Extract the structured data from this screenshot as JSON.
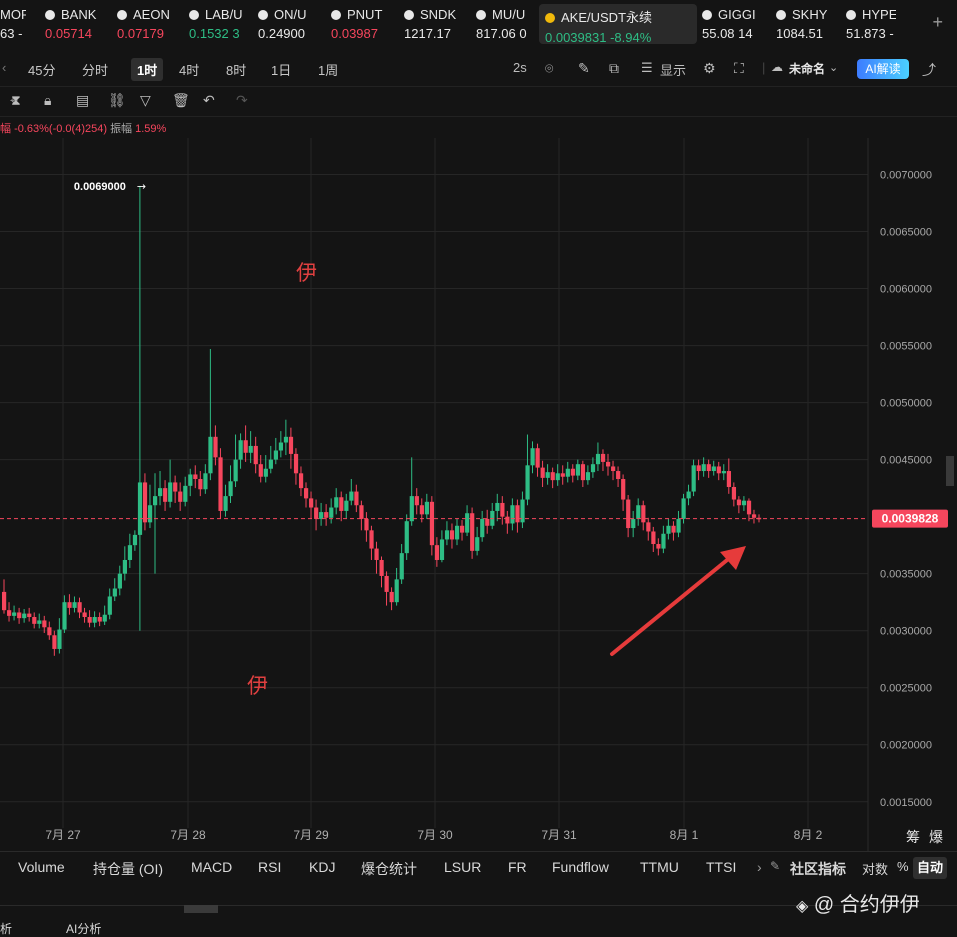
{
  "ticker": [
    {
      "symbol": "MORI",
      "price": "63 -",
      "color": "white"
    },
    {
      "symbol": "BANK",
      "price": "0.05714",
      "color": "red"
    },
    {
      "symbol": "AEON",
      "price": "0.07179",
      "color": "red"
    },
    {
      "symbol": "LAB/U",
      "price": "0.1532 3",
      "color": "green"
    },
    {
      "symbol": "ON/U",
      "price": "0.24900",
      "color": "white"
    },
    {
      "symbol": "PNUT",
      "price": "0.03987",
      "color": "red"
    },
    {
      "symbol": "SNDK",
      "price": "1217.17",
      "color": "white"
    },
    {
      "symbol": "MU/U",
      "price": "817.06 0",
      "color": "white"
    },
    {
      "symbol": "AKE/USDT永续",
      "price": "0.0039831 -8.94%",
      "color": "green",
      "active": true
    },
    {
      "symbol": "GIGGI",
      "price": "55.08 14",
      "color": "white"
    },
    {
      "symbol": "SKHY",
      "price": "1084.51",
      "color": "white"
    },
    {
      "symbol": "HYPE",
      "price": "51.873 -",
      "color": "white"
    }
  ],
  "add_label": "+",
  "timeframes": [
    "45分",
    "分时",
    "1时",
    "4时",
    "8时",
    "1日",
    "1周"
  ],
  "timeframe_selected": "1时",
  "toolbar": {
    "interval": "2s",
    "display": "显示",
    "layout_name": "未命名",
    "ai": "AI解读"
  },
  "info_line": {
    "prefix": "幅",
    "change": "-0.63%(-0.0(4)254)",
    "amp_label": "振幅",
    "amp_value": "1.59%"
  },
  "chart_data": {
    "type": "candlestick",
    "pair": "AKE/USDT永续",
    "y_ticks": [
      "0.0070000",
      "0.0065000",
      "0.0060000",
      "0.0055000",
      "0.0050000",
      "0.0045000",
      "0.0035000",
      "0.0030000",
      "0.0025000",
      "0.0020000",
      "0.0015000"
    ],
    "x_ticks": [
      "7月 27",
      "7月 28",
      "7月 29",
      "7月 30",
      "7月 31",
      "8月 1",
      "8月 2"
    ],
    "ylim": [
      0.00127,
      0.00732
    ],
    "current_price": "0.0039828",
    "current_value": 0.0039828,
    "high_label": "0.0069000",
    "high_value": 0.0069,
    "annotations": [
      "伊",
      "伊"
    ],
    "colors": {
      "up": "#2ebd85",
      "down": "#f6465d",
      "grid": "#262626"
    },
    "candles": [
      [
        0.00334,
        0.00318,
        0.00345,
        0.00315
      ],
      [
        0.00318,
        0.00313,
        0.00325,
        0.00308
      ],
      [
        0.00313,
        0.00316,
        0.00322,
        0.00309
      ],
      [
        0.00316,
        0.00311,
        0.0032,
        0.00306
      ],
      [
        0.00311,
        0.00315,
        0.00319,
        0.00307
      ],
      [
        0.00315,
        0.00312,
        0.0032,
        0.00308
      ],
      [
        0.00312,
        0.00306,
        0.00316,
        0.00302
      ],
      [
        0.00306,
        0.00309,
        0.00315,
        0.00302
      ],
      [
        0.00309,
        0.00303,
        0.00313,
        0.00298
      ],
      [
        0.00303,
        0.00296,
        0.00308,
        0.00292
      ],
      [
        0.00296,
        0.00284,
        0.003,
        0.00278
      ],
      [
        0.00284,
        0.00301,
        0.00311,
        0.0028
      ],
      [
        0.00301,
        0.00325,
        0.00331,
        0.00298
      ],
      [
        0.00325,
        0.0032,
        0.00332,
        0.00314
      ],
      [
        0.0032,
        0.00325,
        0.0033,
        0.00316
      ],
      [
        0.00325,
        0.00316,
        0.00329,
        0.00311
      ],
      [
        0.00316,
        0.00312,
        0.0032,
        0.00307
      ],
      [
        0.00312,
        0.00307,
        0.00318,
        0.00303
      ],
      [
        0.00307,
        0.00312,
        0.00317,
        0.00303
      ],
      [
        0.00312,
        0.00308,
        0.00316,
        0.00304
      ],
      [
        0.00308,
        0.00314,
        0.00322,
        0.00305
      ],
      [
        0.00314,
        0.0033,
        0.00337,
        0.0031
      ],
      [
        0.0033,
        0.00337,
        0.00346,
        0.00326
      ],
      [
        0.00337,
        0.0035,
        0.00357,
        0.00331
      ],
      [
        0.0035,
        0.00362,
        0.00374,
        0.00344
      ],
      [
        0.00362,
        0.00375,
        0.00385,
        0.00355
      ],
      [
        0.00375,
        0.00384,
        0.00388,
        0.0037
      ],
      [
        0.00384,
        0.0043,
        0.0069,
        0.003
      ],
      [
        0.0043,
        0.00395,
        0.00438,
        0.00388
      ],
      [
        0.00395,
        0.0041,
        0.00428,
        0.0039
      ],
      [
        0.0041,
        0.00418,
        0.00438,
        0.0035
      ],
      [
        0.00418,
        0.00425,
        0.0044,
        0.0041
      ],
      [
        0.00425,
        0.00413,
        0.00432,
        0.00405
      ],
      [
        0.00413,
        0.0043,
        0.0045,
        0.00408
      ],
      [
        0.0043,
        0.00422,
        0.00436,
        0.00412
      ],
      [
        0.00422,
        0.00413,
        0.0043,
        0.00405
      ],
      [
        0.00413,
        0.00427,
        0.00435,
        0.00409
      ],
      [
        0.00427,
        0.00437,
        0.00442,
        0.00418
      ],
      [
        0.00437,
        0.00433,
        0.00445,
        0.00425
      ],
      [
        0.00433,
        0.00424,
        0.0044,
        0.00418
      ],
      [
        0.00424,
        0.00438,
        0.00446,
        0.0042
      ],
      [
        0.00438,
        0.0047,
        0.00547,
        0.00432
      ],
      [
        0.0047,
        0.00452,
        0.0048,
        0.00445
      ],
      [
        0.00452,
        0.00405,
        0.0046,
        0.00398
      ],
      [
        0.00405,
        0.00418,
        0.00428,
        0.004
      ],
      [
        0.00418,
        0.00431,
        0.00445,
        0.00412
      ],
      [
        0.00431,
        0.0045,
        0.00472,
        0.00426
      ],
      [
        0.0045,
        0.00467,
        0.00473,
        0.00442
      ],
      [
        0.00467,
        0.00456,
        0.0048,
        0.00448
      ],
      [
        0.00456,
        0.00462,
        0.00475,
        0.00447
      ],
      [
        0.00462,
        0.00446,
        0.0047,
        0.00438
      ],
      [
        0.00446,
        0.00435,
        0.00454,
        0.0043
      ],
      [
        0.00435,
        0.00442,
        0.00454,
        0.0043
      ],
      [
        0.00442,
        0.0045,
        0.00462,
        0.00438
      ],
      [
        0.0045,
        0.00458,
        0.00469,
        0.00446
      ],
      [
        0.00458,
        0.00465,
        0.00475,
        0.00452
      ],
      [
        0.00465,
        0.0047,
        0.00485,
        0.00454
      ],
      [
        0.0047,
        0.00455,
        0.00478,
        0.00442
      ],
      [
        0.00455,
        0.00438,
        0.0046,
        0.00428
      ],
      [
        0.00438,
        0.00425,
        0.00444,
        0.00418
      ],
      [
        0.00425,
        0.00416,
        0.0043,
        0.00408
      ],
      [
        0.00416,
        0.00408,
        0.00422,
        0.00398
      ],
      [
        0.00408,
        0.00398,
        0.00415,
        0.00388
      ],
      [
        0.00398,
        0.00404,
        0.00412,
        0.00392
      ],
      [
        0.00404,
        0.00399,
        0.00411,
        0.00392
      ],
      [
        0.00399,
        0.00408,
        0.00416,
        0.00394
      ],
      [
        0.00408,
        0.00417,
        0.00425,
        0.00402
      ],
      [
        0.00417,
        0.00405,
        0.00422,
        0.00396
      ],
      [
        0.00405,
        0.00414,
        0.0042,
        0.00398
      ],
      [
        0.00414,
        0.00422,
        0.00433,
        0.0041
      ],
      [
        0.00422,
        0.0041,
        0.00428,
        0.00404
      ],
      [
        0.0041,
        0.00398,
        0.00414,
        0.00388
      ],
      [
        0.00398,
        0.00388,
        0.00404,
        0.00378
      ],
      [
        0.00388,
        0.00372,
        0.00392,
        0.00362
      ],
      [
        0.00372,
        0.00362,
        0.00378,
        0.0035
      ],
      [
        0.00362,
        0.00348,
        0.00365,
        0.00338
      ],
      [
        0.00348,
        0.00334,
        0.00352,
        0.00322
      ],
      [
        0.00334,
        0.00325,
        0.00338,
        0.00318
      ],
      [
        0.00325,
        0.00345,
        0.00355,
        0.00322
      ],
      [
        0.00345,
        0.00368,
        0.00376,
        0.00341
      ],
      [
        0.00368,
        0.00396,
        0.00402,
        0.00362
      ],
      [
        0.00396,
        0.00418,
        0.00452,
        0.00392
      ],
      [
        0.00418,
        0.0041,
        0.00425,
        0.00402
      ],
      [
        0.0041,
        0.00402,
        0.00416,
        0.00395
      ],
      [
        0.00402,
        0.00413,
        0.0042,
        0.00398
      ],
      [
        0.00413,
        0.00375,
        0.00418,
        0.00366
      ],
      [
        0.00375,
        0.00362,
        0.00382,
        0.00356
      ],
      [
        0.00362,
        0.0038,
        0.00388,
        0.0036
      ],
      [
        0.0038,
        0.00388,
        0.00396,
        0.00375
      ],
      [
        0.00388,
        0.0038,
        0.00394,
        0.00372
      ],
      [
        0.0038,
        0.00392,
        0.00398,
        0.00375
      ],
      [
        0.00392,
        0.00386,
        0.00397,
        0.00379
      ],
      [
        0.00386,
        0.00403,
        0.0041,
        0.00383
      ],
      [
        0.00403,
        0.0037,
        0.00408,
        0.00363
      ],
      [
        0.0037,
        0.00382,
        0.00391,
        0.00366
      ],
      [
        0.00382,
        0.00398,
        0.00405,
        0.00378
      ],
      [
        0.00398,
        0.00392,
        0.00406,
        0.00385
      ],
      [
        0.00392,
        0.00405,
        0.00412,
        0.00389
      ],
      [
        0.00405,
        0.00412,
        0.0042,
        0.00396
      ],
      [
        0.00412,
        0.004,
        0.00418,
        0.00393
      ],
      [
        0.004,
        0.00394,
        0.00405,
        0.00385
      ],
      [
        0.00394,
        0.0041,
        0.00416,
        0.00388
      ],
      [
        0.0041,
        0.00395,
        0.00415,
        0.00386
      ],
      [
        0.00395,
        0.00415,
        0.00422,
        0.0039
      ],
      [
        0.00415,
        0.00445,
        0.00472,
        0.0041
      ],
      [
        0.00445,
        0.0046,
        0.00466,
        0.00438
      ],
      [
        0.0046,
        0.00443,
        0.00464,
        0.00435
      ],
      [
        0.00443,
        0.00434,
        0.00449,
        0.00426
      ],
      [
        0.00434,
        0.00439,
        0.00446,
        0.00428
      ],
      [
        0.00439,
        0.00432,
        0.00443,
        0.00425
      ],
      [
        0.00432,
        0.00438,
        0.00446,
        0.00427
      ],
      [
        0.00438,
        0.00435,
        0.00445,
        0.00428
      ],
      [
        0.00435,
        0.00442,
        0.00448,
        0.0043
      ],
      [
        0.00442,
        0.00436,
        0.00446,
        0.0043
      ],
      [
        0.00436,
        0.00446,
        0.0045,
        0.00432
      ],
      [
        0.00446,
        0.00432,
        0.00449,
        0.00426
      ],
      [
        0.00432,
        0.00439,
        0.00445,
        0.00428
      ],
      [
        0.00439,
        0.00446,
        0.00452,
        0.00434
      ],
      [
        0.00446,
        0.00455,
        0.00465,
        0.0044
      ],
      [
        0.00455,
        0.00448,
        0.00459,
        0.0044
      ],
      [
        0.00448,
        0.00444,
        0.00455,
        0.00436
      ],
      [
        0.00444,
        0.0044,
        0.00449,
        0.00432
      ],
      [
        0.0044,
        0.00433,
        0.00444,
        0.00426
      ],
      [
        0.00433,
        0.00415,
        0.00437,
        0.00405
      ],
      [
        0.00415,
        0.0039,
        0.00419,
        0.00382
      ],
      [
        0.0039,
        0.00398,
        0.00405,
        0.00382
      ],
      [
        0.00398,
        0.0041,
        0.00416,
        0.00392
      ],
      [
        0.0041,
        0.00395,
        0.00414,
        0.00388
      ],
      [
        0.00395,
        0.00387,
        0.00399,
        0.00379
      ],
      [
        0.00387,
        0.00376,
        0.00391,
        0.00369
      ],
      [
        0.00376,
        0.00372,
        0.00381,
        0.00366
      ],
      [
        0.00372,
        0.00385,
        0.00392,
        0.00368
      ],
      [
        0.00385,
        0.00392,
        0.00398,
        0.0038
      ],
      [
        0.00392,
        0.00386,
        0.00396,
        0.00379
      ],
      [
        0.00386,
        0.00398,
        0.00405,
        0.00382
      ],
      [
        0.00398,
        0.00416,
        0.0042,
        0.00394
      ],
      [
        0.00416,
        0.00422,
        0.00428,
        0.0041
      ],
      [
        0.00422,
        0.00445,
        0.0045,
        0.00418
      ],
      [
        0.00445,
        0.0044,
        0.0045,
        0.00432
      ],
      [
        0.0044,
        0.00446,
        0.00452,
        0.00435
      ],
      [
        0.00446,
        0.0044,
        0.0045,
        0.00434
      ],
      [
        0.0044,
        0.00444,
        0.00449,
        0.00436
      ],
      [
        0.00444,
        0.00438,
        0.00448,
        0.00432
      ],
      [
        0.00438,
        0.0044,
        0.00446,
        0.00432
      ],
      [
        0.0044,
        0.00426,
        0.00451,
        0.0042
      ],
      [
        0.00426,
        0.00415,
        0.0043,
        0.00409
      ],
      [
        0.00415,
        0.0041,
        0.00418,
        0.00403
      ],
      [
        0.0041,
        0.00414,
        0.00418,
        0.00405
      ],
      [
        0.00414,
        0.00402,
        0.00416,
        0.00396
      ],
      [
        0.00402,
        0.00399,
        0.00406,
        0.00394
      ],
      [
        0.00399,
        0.00398,
        0.00402,
        0.00395
      ]
    ]
  },
  "indicators": [
    "Volume",
    "持仓量 (OI)",
    "MACD",
    "RSI",
    "KDJ",
    "爆仓统计",
    "LSUR",
    "FR",
    "Fundflow",
    "TTMU",
    "TTSI"
  ],
  "community": "社区指标",
  "scale_log": "对数",
  "scale_pct": "%",
  "scale_auto": "自动",
  "corner_labels": [
    "筹",
    "爆"
  ],
  "watermark": "@ 合约伊伊",
  "bottom_tabs": [
    "析",
    "AI分析"
  ]
}
